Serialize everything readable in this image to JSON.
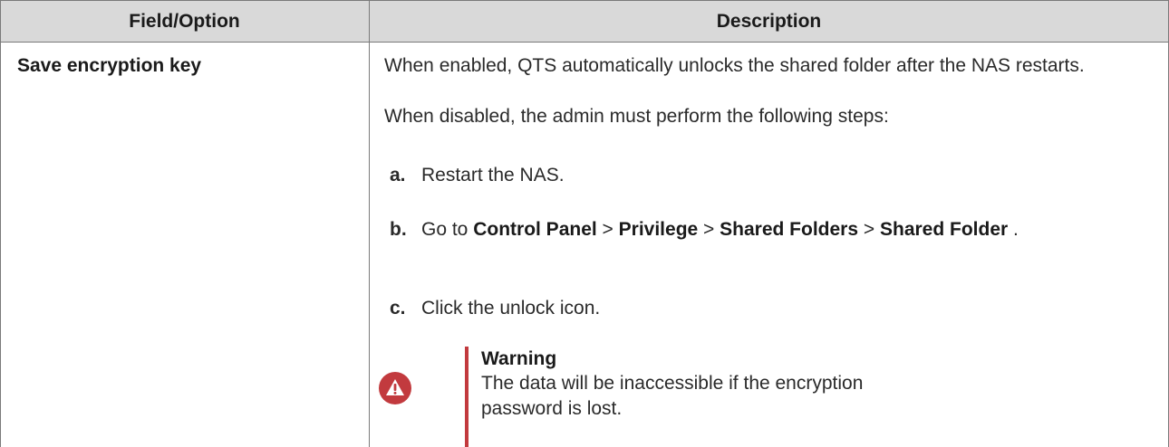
{
  "table": {
    "headers": [
      "Field/Option",
      "Description"
    ],
    "row": {
      "field": "Save encryption key",
      "paragraphs": [
        "When enabled, QTS automatically unlocks the shared folder after the NAS restarts.",
        "When disabled, the admin must perform the following steps:"
      ],
      "steps": [
        {
          "letter": "a.",
          "text": "Restart the NAS."
        },
        {
          "letter": "b.",
          "parts": [
            "Go to ",
            "Control Panel",
            " > ",
            "Privilege",
            " > ",
            "Shared Folders",
            " > ",
            "Shared Folder",
            " ."
          ]
        },
        {
          "letter": "c.",
          "text": "Click the unlock icon."
        }
      ],
      "warning": {
        "icon": "warning-triangle-icon",
        "color": "#c23a3e",
        "title": "Warning",
        "text": "The data will be inaccessible if the encryption password is lost."
      }
    }
  }
}
